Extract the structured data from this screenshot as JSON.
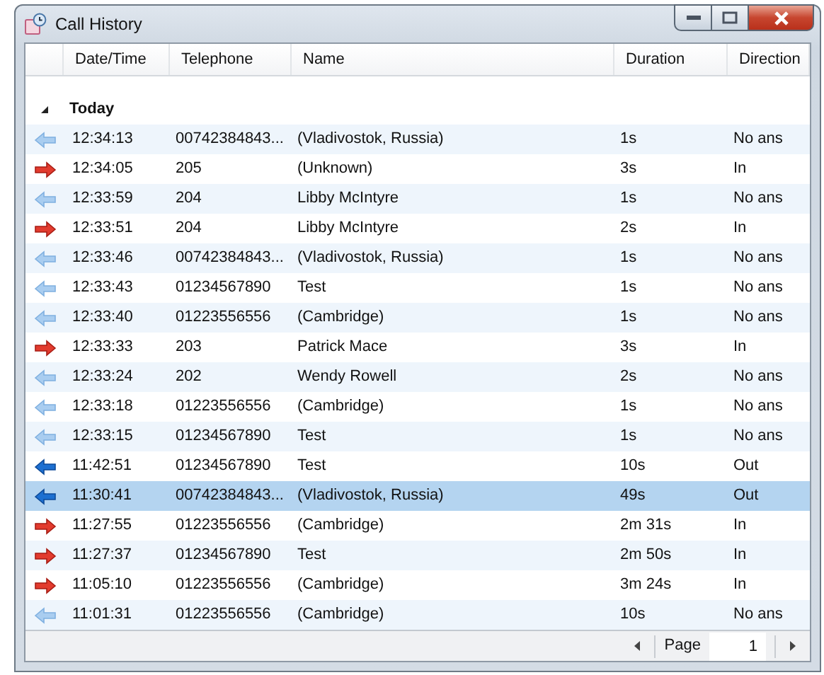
{
  "window": {
    "title": "Call History"
  },
  "columns": [
    "Date/Time",
    "Telephone",
    "Name",
    "Duration",
    "Direction"
  ],
  "group": {
    "label": "Today",
    "expanded": true
  },
  "rows": [
    {
      "kind": "missed",
      "time": "12:34:13",
      "telephone": "00742384843...",
      "name": "(Vladivostok, Russia)",
      "duration": "1s",
      "direction": "No ans",
      "selected": false
    },
    {
      "kind": "incoming",
      "time": "12:34:05",
      "telephone": "205",
      "name": "(Unknown)",
      "duration": "3s",
      "direction": "In",
      "selected": false
    },
    {
      "kind": "missed",
      "time": "12:33:59",
      "telephone": "204",
      "name": "Libby McIntyre",
      "duration": "1s",
      "direction": "No ans",
      "selected": false
    },
    {
      "kind": "incoming",
      "time": "12:33:51",
      "telephone": "204",
      "name": "Libby McIntyre",
      "duration": "2s",
      "direction": "In",
      "selected": false
    },
    {
      "kind": "missed",
      "time": "12:33:46",
      "telephone": "00742384843...",
      "name": "(Vladivostok, Russia)",
      "duration": "1s",
      "direction": "No ans",
      "selected": false
    },
    {
      "kind": "missed",
      "time": "12:33:43",
      "telephone": "01234567890",
      "name": "Test",
      "duration": "1s",
      "direction": "No ans",
      "selected": false
    },
    {
      "kind": "missed",
      "time": "12:33:40",
      "telephone": "01223556556",
      "name": "(Cambridge)",
      "duration": "1s",
      "direction": "No ans",
      "selected": false
    },
    {
      "kind": "incoming",
      "time": "12:33:33",
      "telephone": "203",
      "name": "Patrick Mace",
      "duration": "3s",
      "direction": "In",
      "selected": false
    },
    {
      "kind": "missed",
      "time": "12:33:24",
      "telephone": "202",
      "name": "Wendy Rowell",
      "duration": "2s",
      "direction": "No ans",
      "selected": false
    },
    {
      "kind": "missed",
      "time": "12:33:18",
      "telephone": "01223556556",
      "name": "(Cambridge)",
      "duration": "1s",
      "direction": "No ans",
      "selected": false
    },
    {
      "kind": "missed",
      "time": "12:33:15",
      "telephone": "01234567890",
      "name": "Test",
      "duration": "1s",
      "direction": "No ans",
      "selected": false
    },
    {
      "kind": "outgoing",
      "time": "11:42:51",
      "telephone": "01234567890",
      "name": "Test",
      "duration": "10s",
      "direction": "Out",
      "selected": false
    },
    {
      "kind": "outgoing",
      "time": "11:30:41",
      "telephone": "00742384843...",
      "name": "(Vladivostok, Russia)",
      "duration": "49s",
      "direction": "Out",
      "selected": true
    },
    {
      "kind": "incoming",
      "time": "11:27:55",
      "telephone": "01223556556",
      "name": "(Cambridge)",
      "duration": "2m 31s",
      "direction": "In",
      "selected": false
    },
    {
      "kind": "incoming",
      "time": "11:27:37",
      "telephone": "01234567890",
      "name": "Test",
      "duration": "2m 50s",
      "direction": "In",
      "selected": false
    },
    {
      "kind": "incoming",
      "time": "11:05:10",
      "telephone": "01223556556",
      "name": "(Cambridge)",
      "duration": "3m 24s",
      "direction": "In",
      "selected": false
    },
    {
      "kind": "missed",
      "time": "11:01:31",
      "telephone": "01223556556",
      "name": "(Cambridge)",
      "duration": "10s",
      "direction": "No ans",
      "selected": false
    }
  ],
  "pager": {
    "label": "Page",
    "value": "1"
  }
}
